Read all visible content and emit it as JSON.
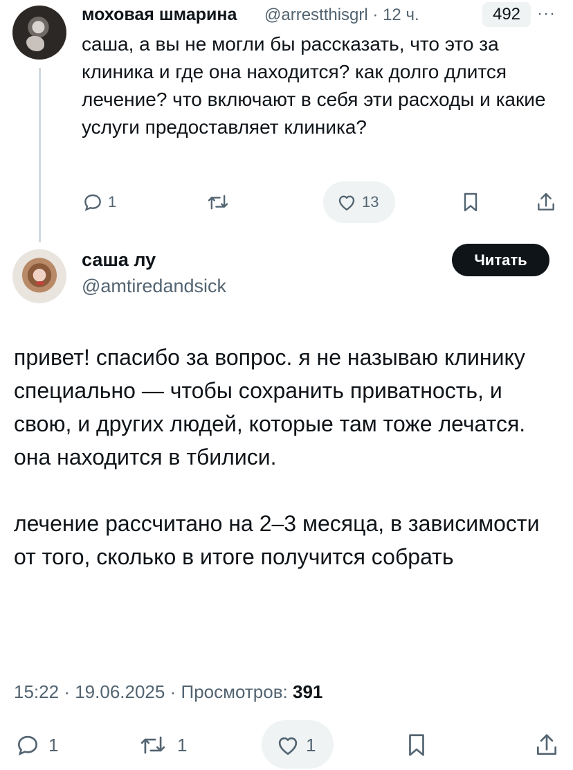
{
  "reply_tweet": {
    "author_name": "моховая шмарина",
    "handle": "@arrestthisgrl",
    "separator": "·",
    "time": "12 ч.",
    "badge_count": "492",
    "more": "···",
    "text": "саша, а вы не могли бы рассказать, что это за клиника и где она находится? как долго длится лечение? что включают в себя эти расходы и какие услуги предоставляет клиника?",
    "actions": {
      "reply_count": "1",
      "retweet_count": "",
      "like_count": "13"
    }
  },
  "main_tweet": {
    "author_name": "саша лу",
    "handle": "@amtiredandsick",
    "follow_label": "Читать",
    "paragraphs": [
      "привет! спасибо за вопрос. я не называю клинику специально — чтобы сохранить приватность, и свою, и других людей, которые там тоже лечатся. она находится в тбилиси.",
      "лечение рассчитано на 2–3 месяца, в зависимости от того, сколько в итоге получится собрать"
    ],
    "time": "15:22",
    "sep1": "·",
    "date": "19.06.2025",
    "sep2": "·",
    "views_label": "Просмотров:",
    "views_count": "391",
    "actions": {
      "reply_count": "1",
      "retweet_count": "1",
      "like_count": "1"
    }
  },
  "icons": [
    "reply-icon",
    "retweet-icon",
    "like-icon",
    "bookmark-icon",
    "share-icon"
  ]
}
